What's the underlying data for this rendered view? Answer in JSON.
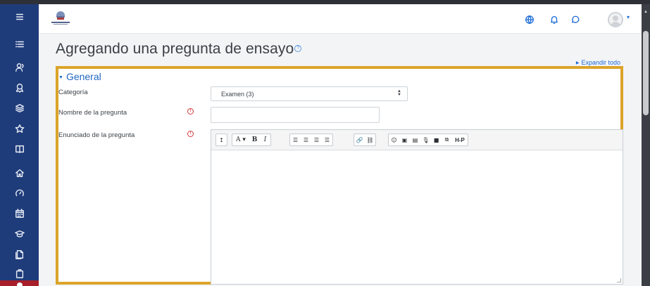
{
  "page": {
    "title": "Agregando una pregunta de ensayo",
    "expand_all": "Expandir todo"
  },
  "form": {
    "section_title": "General",
    "category_label": "Categoría",
    "category_value": "Examen (3)",
    "question_name_label": "Nombre de la pregunta",
    "question_name_value": "",
    "question_text_label": "Enunciado de la pregunta",
    "question_text_value": ""
  },
  "editor": {
    "toolbar": [
      {
        "name": "toolbar-toggle-button",
        "label": "↥"
      },
      {
        "name": "font-size-button",
        "label": "A ▾"
      },
      {
        "name": "bold-button",
        "label": "B"
      },
      {
        "name": "italic-button",
        "label": "I"
      },
      {
        "name": "unordered-list-button",
        "label": "☰"
      },
      {
        "name": "ordered-list-button",
        "label": "☰"
      },
      {
        "name": "outdent-button",
        "label": "☰"
      },
      {
        "name": "indent-button",
        "label": "☰"
      },
      {
        "name": "link-button",
        "label": "🔗"
      },
      {
        "name": "unlink-button",
        "label": "⛓"
      },
      {
        "name": "emoji-button",
        "label": "☺"
      },
      {
        "name": "image-button",
        "label": "▣"
      },
      {
        "name": "media-button",
        "label": "▤"
      },
      {
        "name": "record-audio-button",
        "label": "🎙"
      },
      {
        "name": "record-video-button",
        "label": "■"
      },
      {
        "name": "manage-files-button",
        "label": "⧉"
      },
      {
        "name": "h5p-button",
        "label": "H-P"
      }
    ]
  },
  "navbar": {
    "icons": [
      "globe-icon",
      "bell-icon",
      "chat-icon",
      "user-avatar",
      "chevron-down-icon"
    ]
  },
  "sidebar": {
    "icons": [
      "hamburger-icon",
      "list-icon",
      "users-icon",
      "badge-icon",
      "layers-icon",
      "star-icon",
      "book-icon",
      "home-icon",
      "dashboard-icon",
      "calendar-icon",
      "graduation-icon",
      "files-icon",
      "clipboard-icon"
    ]
  },
  "colors": {
    "sidebar": "#1f3c7a",
    "accent": "#2268c4",
    "highlight_border": "#dba42a",
    "required": "#d33a3a"
  }
}
